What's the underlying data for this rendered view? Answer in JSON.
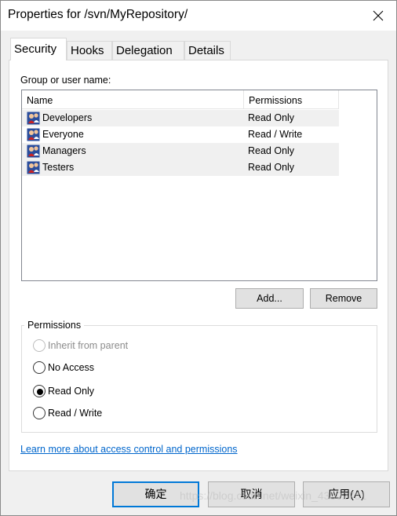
{
  "window": {
    "title": "Properties for /svn/MyRepository/"
  },
  "tabs": [
    {
      "label": "Security",
      "active": true
    },
    {
      "label": "Hooks",
      "active": false
    },
    {
      "label": "Delegation",
      "active": false
    },
    {
      "label": "Details",
      "active": false
    }
  ],
  "security": {
    "group_label": "Group or user name:",
    "columns": {
      "name": "Name",
      "permissions": "Permissions"
    },
    "rows": [
      {
        "name": "Developers",
        "permission": "Read Only",
        "icon": "group-icon"
      },
      {
        "name": "Everyone",
        "permission": "Read / Write",
        "icon": "group-icon"
      },
      {
        "name": "Managers",
        "permission": "Read Only",
        "icon": "group-icon"
      },
      {
        "name": "Testers",
        "permission": "Read Only",
        "icon": "group-icon"
      }
    ],
    "add_button": "Add...",
    "remove_button": "Remove",
    "permissions_group": {
      "title": "Permissions",
      "options": [
        {
          "label": "Inherit from parent",
          "selected": false,
          "disabled": true
        },
        {
          "label": "No Access",
          "selected": false,
          "disabled": false
        },
        {
          "label": "Read Only",
          "selected": true,
          "disabled": false
        },
        {
          "label": "Read / Write",
          "selected": false,
          "disabled": false
        }
      ]
    },
    "learn_more_link": "Learn more about access control and permissions"
  },
  "footer": {
    "ok": "确定",
    "cancel": "取消",
    "apply": "应用(A)"
  },
  "watermark": "https://blog.csdn.net/weixin_43502781",
  "colors": {
    "accent": "#0078d7",
    "link": "#0066cc",
    "row_shade": "#f0f0f0"
  }
}
